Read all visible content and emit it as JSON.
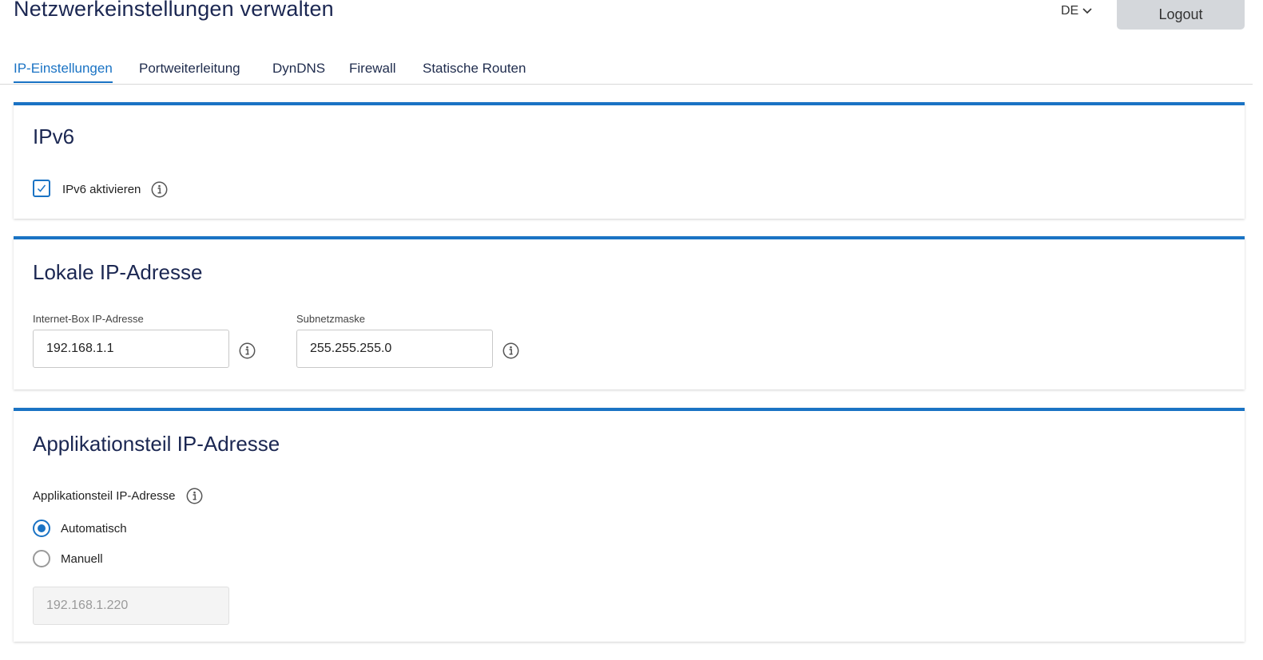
{
  "header": {
    "title": "Netzwerkeinstellungen verwalten",
    "language": "DE",
    "logout_label": "Logout"
  },
  "tabs": [
    {
      "label": "IP-Einstellungen",
      "active": true
    },
    {
      "label": "Portweiterleitung",
      "active": false
    },
    {
      "label": "DynDNS",
      "active": false
    },
    {
      "label": "Firewall",
      "active": false
    },
    {
      "label": "Statische Routen",
      "active": false
    }
  ],
  "ipv6": {
    "title": "IPv6",
    "checkbox_label": "IPv6 aktivieren",
    "checked": true
  },
  "local_ip": {
    "title": "Lokale IP-Adresse",
    "box_ip_label": "Internet-Box IP-Adresse",
    "box_ip_value": "192.168.1.1",
    "subnet_label": "Subnetzmaske",
    "subnet_value": "255.255.255.0"
  },
  "app_ip": {
    "title": "Applikationsteil IP-Adresse",
    "field_label": "Applikationsteil IP-Adresse",
    "options": [
      {
        "label": "Automatisch",
        "checked": true
      },
      {
        "label": "Manuell",
        "checked": false
      }
    ],
    "manual_value": "192.168.1.220"
  },
  "colors": {
    "accent": "#1a73c4",
    "title_text": "#1b2752",
    "logout_bg": "#d4d7db"
  }
}
